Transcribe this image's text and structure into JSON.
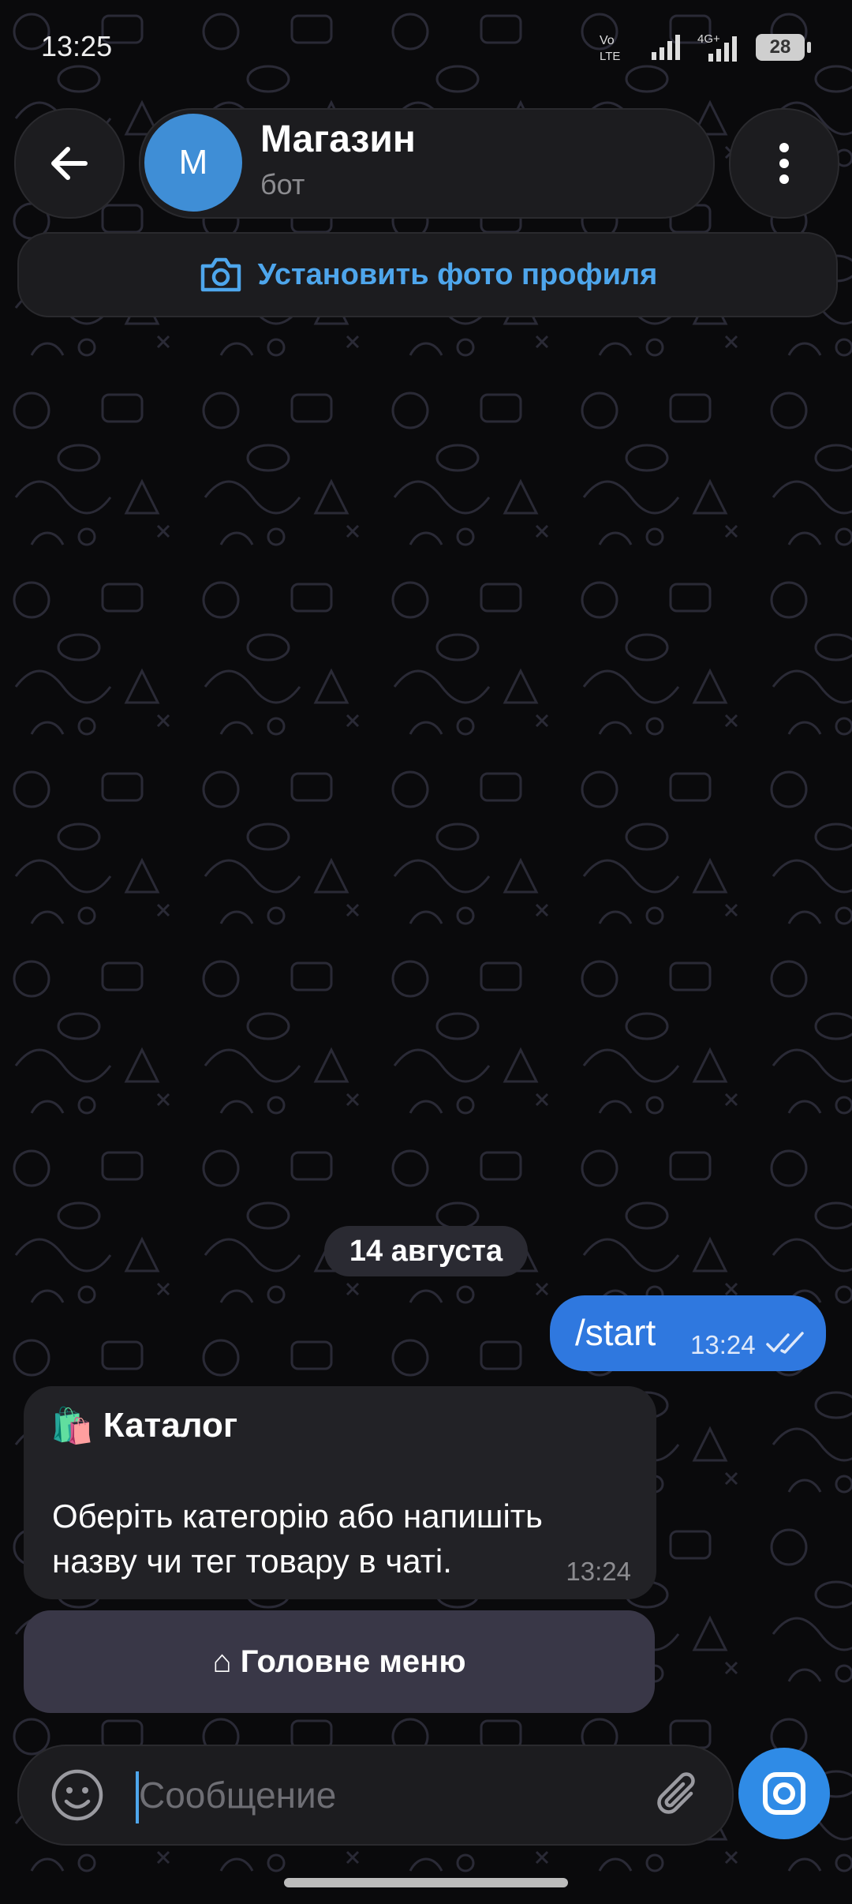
{
  "status_bar": {
    "time": "13:25",
    "battery": "28"
  },
  "header": {
    "avatar_letter": "М",
    "chat_name": "Магазин",
    "chat_subtitle": "бот",
    "back_icon": "arrow-left-icon",
    "menu_icon": "vertical-dots-icon"
  },
  "set_photo": {
    "label": "Установить фото профиля",
    "icon": "camera-icon"
  },
  "date_badge": "14 августа",
  "messages": {
    "outgoing": {
      "text": "/start",
      "time": "13:24"
    },
    "incoming": {
      "title_emoji": "🛍️",
      "title": "Каталог",
      "body": "Оберіть категорію або напишіть назву чи тег товару в чаті.",
      "time": "13:24"
    }
  },
  "keyboard_button": {
    "label": "⌂ Головне меню"
  },
  "composer": {
    "placeholder": "Сообщение"
  },
  "colors": {
    "accent": "#2f78df",
    "link": "#4ea6ec",
    "keyboard_button": "#393747"
  }
}
